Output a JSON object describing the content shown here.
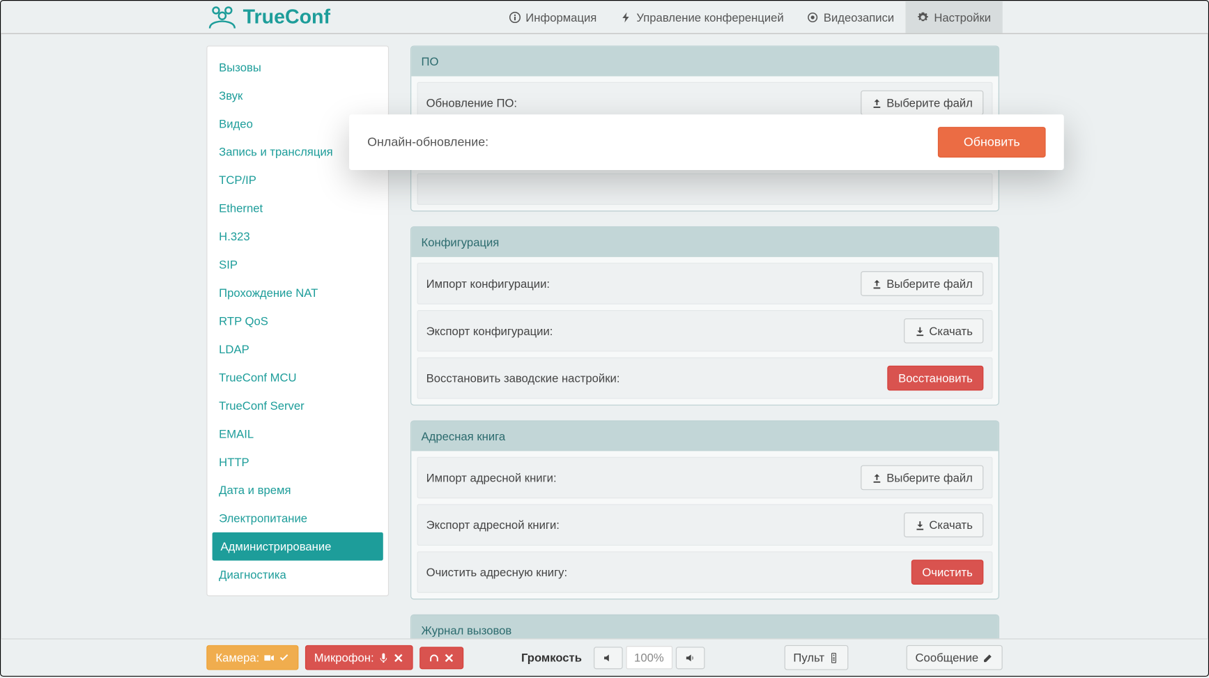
{
  "brand": "TrueConf",
  "nav": {
    "info": "Информация",
    "conf": "Управление конференцией",
    "rec": "Видеозаписи",
    "settings": "Настройки"
  },
  "sidebar": {
    "items": [
      "Вызовы",
      "Звук",
      "Видео",
      "Запись и трансляция",
      "TCP/IP",
      "Ethernet",
      "H.323",
      "SIP",
      "Прохождение NAT",
      "RTP QoS",
      "LDAP",
      "TrueConf MCU",
      "TrueConf Server",
      "EMAIL",
      "HTTP",
      "Дата и время",
      "Электропитание",
      "Администрирование",
      "Диагностика"
    ],
    "activeIndex": 17
  },
  "highlight": {
    "label": "Онлайн-обновление:",
    "button": "Обновить"
  },
  "panels": {
    "po": {
      "title": "ПО",
      "row1_label": "Обновление ПО:",
      "row1_btn": "Выберите файл"
    },
    "config": {
      "title": "Конфигурация",
      "import_label": "Импорт конфигурации:",
      "import_btn": "Выберите файл",
      "export_label": "Экспорт конфигурации:",
      "export_btn": "Скачать",
      "reset_label": "Восстановить заводские настройки:",
      "reset_btn": "Восстановить"
    },
    "abook": {
      "title": "Адресная книга",
      "import_label": "Импорт адресной книги:",
      "import_btn": "Выберите файл",
      "export_label": "Экспорт адресной книги:",
      "export_btn": "Скачать",
      "clear_label": "Очистить адресную книгу:",
      "clear_btn": "Очистить"
    },
    "log": {
      "title": "Журнал вызовов"
    }
  },
  "footer": {
    "camera": "Камера:",
    "mic": "Микрофон:",
    "volume_label": "Громкость",
    "volume_value": "100%",
    "remote": "Пульт",
    "message": "Сообщение"
  }
}
